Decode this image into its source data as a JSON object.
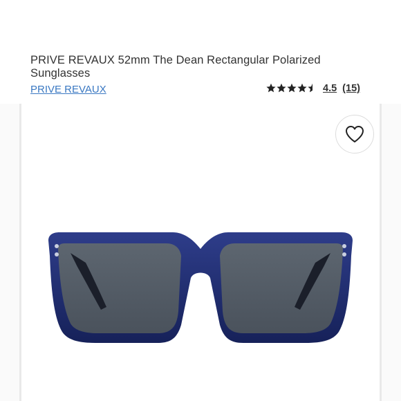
{
  "product": {
    "title": "PRIVE REVAUX 52mm The Dean Rectangular Polarized Sunglasses",
    "brand": "PRIVE REVAUX"
  },
  "rating": {
    "value": "4.5",
    "count": "(15)",
    "stars_filled": 4.5
  },
  "icons": {
    "favorite": "heart-outline-icon"
  },
  "colors": {
    "frame": "#1f2c6e",
    "lens": "#56606a",
    "link": "#3a78c2"
  }
}
